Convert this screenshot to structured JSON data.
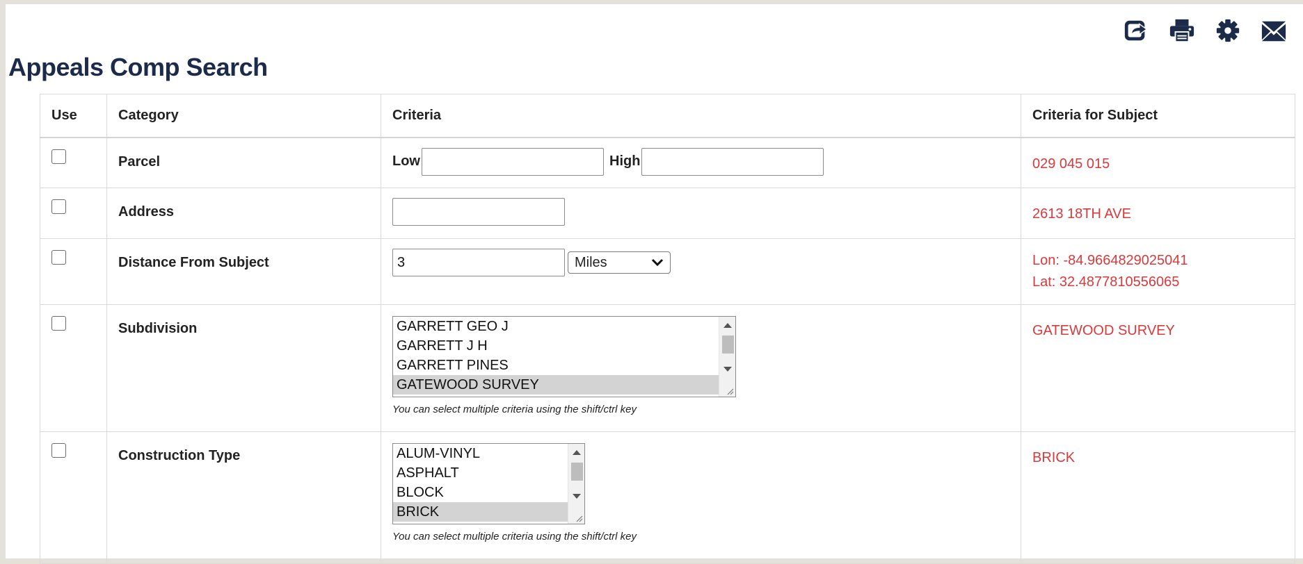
{
  "page": {
    "title": "Appeals Comp Search"
  },
  "toolbar": {
    "icons": [
      "share-icon",
      "print-icon",
      "gear-icon",
      "email-icon"
    ]
  },
  "table": {
    "headers": {
      "use": "Use",
      "category": "Category",
      "criteria": "Criteria",
      "subject": "Criteria for Subject"
    },
    "rows": {
      "parcel": {
        "category": "Parcel",
        "low_label": "Low",
        "high_label": "High",
        "low_value": "",
        "high_value": "",
        "subject": "029 045 015"
      },
      "address": {
        "category": "Address",
        "value": "",
        "subject": "2613 18TH AVE"
      },
      "distance": {
        "category": "Distance From Subject",
        "value": "3",
        "unit": "Miles",
        "subject_lon": "Lon: -84.9664829025041",
        "subject_lat": "Lat: 32.4877810556065"
      },
      "subdivision": {
        "category": "Subdivision",
        "options": [
          "GARRETT GEO J",
          "GARRETT J H",
          "GARRETT PINES",
          "GATEWOOD SURVEY"
        ],
        "selected": "GATEWOOD SURVEY",
        "hint": "You can select multiple criteria using the shift/ctrl key",
        "subject": "GATEWOOD SURVEY"
      },
      "construction": {
        "category": "Construction Type",
        "options": [
          "ALUM-VINYL",
          "ASPHALT",
          "BLOCK",
          "BRICK"
        ],
        "selected": "BRICK",
        "hint": "You can select multiple criteria using the shift/ctrl key",
        "subject": "BRICK"
      }
    }
  }
}
